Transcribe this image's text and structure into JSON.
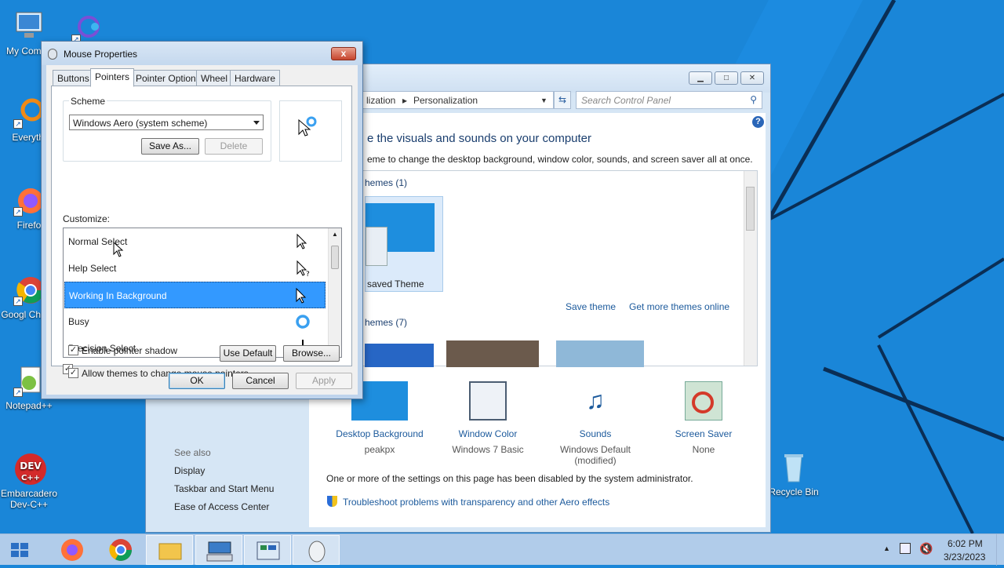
{
  "desktop": {
    "icons": [
      {
        "label": "My Compu"
      },
      {
        "label": "Everythi"
      },
      {
        "label": "Firefo"
      },
      {
        "label": "Googl Chrom"
      },
      {
        "label": "Notepad++"
      },
      {
        "label": "Embarcadero Dev-C++"
      },
      {
        "label": "Recycle Bin"
      }
    ],
    "dev_icon_text": "DEV",
    "dev_icon_sub": "C++"
  },
  "control_panel": {
    "breadcrumb": [
      "lization",
      "Personalization"
    ],
    "search_placeholder": "Search Control Panel",
    "heading": "e the visuals and sounds on your computer",
    "subheading": "eme to change the desktop background, window color, sounds, and screen saver all at once.",
    "my_themes_label": "hemes (1)",
    "unsaved_theme_label": "saved Theme",
    "save_theme": "Save theme",
    "get_more_themes": "Get more themes online",
    "aero_themes_label": "hemes (7)",
    "bottom_items": [
      {
        "title": "Desktop Background",
        "sub": "peakpx"
      },
      {
        "title": "Window Color",
        "sub": "Windows 7 Basic"
      },
      {
        "title": "Sounds",
        "sub": "Windows Default (modified)"
      },
      {
        "title": "Screen Saver",
        "sub": "None"
      }
    ],
    "see_also": {
      "title": "See also",
      "links": [
        "Display",
        "Taskbar and Start Menu",
        "Ease of Access Center"
      ]
    },
    "admin_notice": "One or more of the settings on this page has been disabled by the system administrator.",
    "troubleshoot_link": "Troubleshoot problems with transparency and other Aero effects",
    "help_glyph": "?"
  },
  "mouse_properties": {
    "title": "Mouse Properties",
    "close_glyph": "x",
    "tabs": [
      "Buttons",
      "Pointers",
      "Pointer Options",
      "Wheel",
      "Hardware"
    ],
    "active_tab": "Pointers",
    "scheme": {
      "label": "Scheme",
      "selected": "Windows Aero (system scheme)",
      "save_as": "Save As...",
      "delete": "Delete"
    },
    "customize_label": "Customize:",
    "pointers": [
      {
        "name": "Normal Select",
        "icon": "arrow-cursor-icon"
      },
      {
        "name": "Help Select",
        "icon": "help-cursor-icon"
      },
      {
        "name": "Working In Background",
        "icon": "working-cursor-icon",
        "selected": true
      },
      {
        "name": "Busy",
        "icon": "busy-ring-icon"
      },
      {
        "name": "Precision Select",
        "icon": "crosshair-cursor-icon"
      }
    ],
    "enable_shadow": "Enable pointer shadow",
    "allow_themes": "Allow themes to change mouse pointers",
    "use_default": "Use Default",
    "browse": "Browse...",
    "ok": "OK",
    "cancel": "Cancel",
    "apply": "Apply",
    "check_glyph": "✓",
    "help_badge": "?"
  },
  "taskbar": {
    "time": "6:02 PM",
    "date": "3/23/2023",
    "items": [
      "start-button",
      "firefox-icon",
      "chrome-icon",
      "file-explorer-icon",
      "keyboard-app-icon",
      "control-panel-icon",
      "mouse-icon"
    ],
    "tray_arrow": "▲"
  },
  "colors": {
    "accent": "#3399ff",
    "wallpaper": "#1a86d8",
    "link": "#1c5a9c"
  }
}
